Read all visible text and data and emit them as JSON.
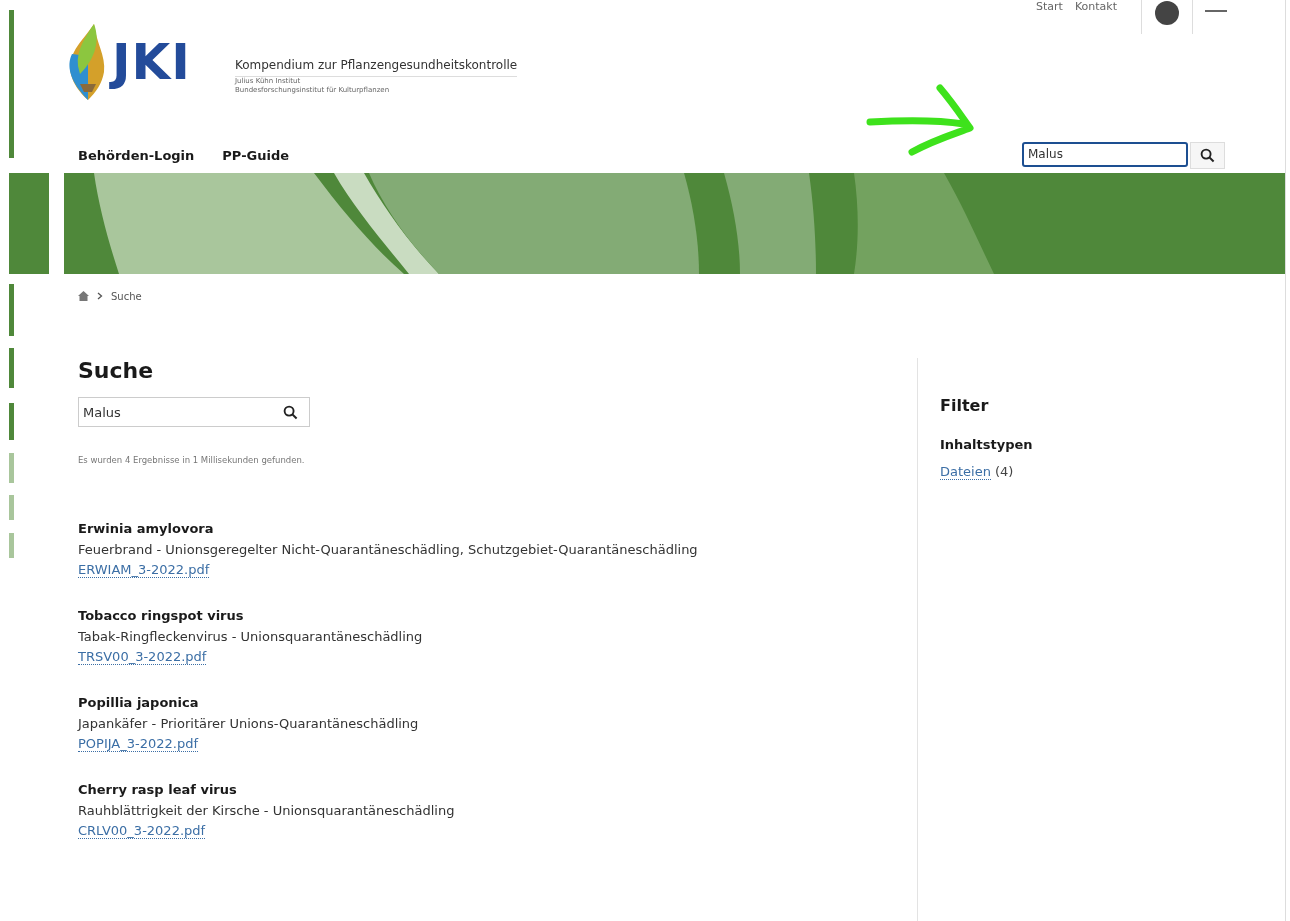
{
  "utility_nav": {
    "links": [
      "Start",
      "Kontakt"
    ]
  },
  "site": {
    "logo_text": "JKI",
    "title": "Kompendium zur Pflanzengesundheitskontrolle",
    "subtitle_1": "Julius Kühn Institut",
    "subtitle_2": "Bundesforschungsinstitut für Kulturpflanzen"
  },
  "main_nav": [
    "Behörden-Login",
    "PP-Guide"
  ],
  "header_search": {
    "value": "Malus"
  },
  "breadcrumb": [
    "Suche"
  ],
  "search": {
    "heading": "Suche",
    "value": "Malus",
    "summary": "Es wurden 4 Ergebnisse in 1 Millisekunden gefunden."
  },
  "results": [
    {
      "title": "Erwinia amylovora",
      "description": "Feuerbrand - Unionsgeregelter Nicht-Quarantäneschädling, Schutzgebiet-Quarantäneschädling",
      "file": "ERWIAM_3-2022.pdf"
    },
    {
      "title": "Tobacco ringspot virus",
      "description": "Tabak-Ringfleckenvirus - Unionsquarantäneschädling",
      "file": "TRSV00_3-2022.pdf"
    },
    {
      "title": "Popillia japonica",
      "description": "Japankäfer - Prioritärer Unions-Quarantäneschädling",
      "file": "POPIJA_3-2022.pdf"
    },
    {
      "title": "Cherry rasp leaf virus",
      "description": "Rauhblättrigkeit der Kirsche - Unionsquarantäneschädling",
      "file": "CRLV00_3-2022.pdf"
    }
  ],
  "filter": {
    "heading": "Filter",
    "group": "Inhaltstypen",
    "items": [
      {
        "label": "Dateien",
        "count": "(4)"
      }
    ]
  }
}
